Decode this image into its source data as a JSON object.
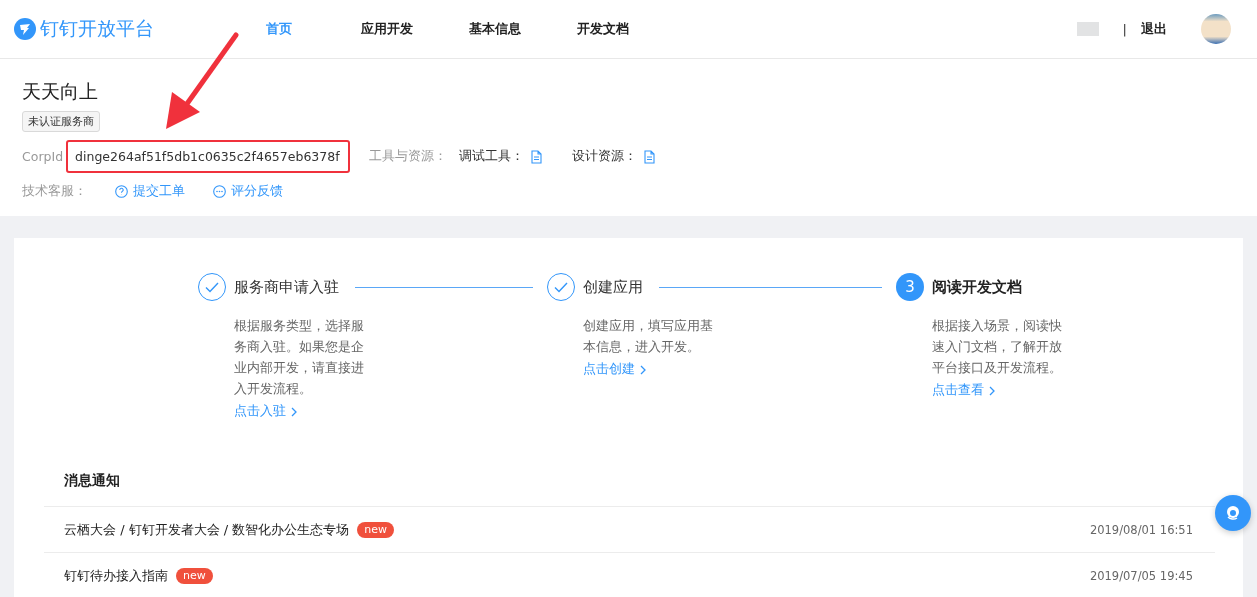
{
  "header": {
    "logo": "钉钉开放平台",
    "nav": [
      {
        "label": "首页",
        "selected": true
      },
      {
        "label": "应用开发",
        "selected": false
      },
      {
        "label": "基本信息",
        "selected": false
      },
      {
        "label": "开发文档",
        "selected": false
      }
    ],
    "separator": "|",
    "logout": "退出"
  },
  "profile": {
    "name": "天天向上",
    "badge": "未认证服务商",
    "corpid_label": "CorpId",
    "corpid": "dinge264af51f5db1c0635c2f4657eb6378f",
    "corpid_highlighted": true,
    "tools_label": "工具与资源：",
    "tools": [
      "调试工具：",
      "设计资源："
    ],
    "support_label": "技术客服：",
    "support": [
      {
        "kind": "ticket",
        "label": "提交工单"
      },
      {
        "kind": "feedback",
        "label": "评分反馈"
      }
    ]
  },
  "steps": [
    {
      "completed": true,
      "title": "服务商申请入驻",
      "description": "根据服务类型，选择服务商入驻。如果您是企业内部开发，请直接进入开发流程。",
      "link": "点击入驻"
    },
    {
      "completed": true,
      "title": "创建应用",
      "description": "创建应用，填写应用基本信息，进入开发。",
      "link": "点击创建"
    },
    {
      "completed": false,
      "number": "3",
      "title": "阅读开发文档",
      "description": "根据接入场景，阅读快速入门文档，了解开放平台接口及开发流程。",
      "link": "点击查看"
    }
  ],
  "notices": {
    "title": "消息通知",
    "items": [
      {
        "title": "云栖大会 / 钉钉开发者大会 / 数智化办公生态专场",
        "badge": "new",
        "time": "2019/08/01 16:51"
      },
      {
        "title": "钉钉待办接入指南",
        "badge": "new",
        "time": "2019/07/05 19:45"
      }
    ]
  }
}
